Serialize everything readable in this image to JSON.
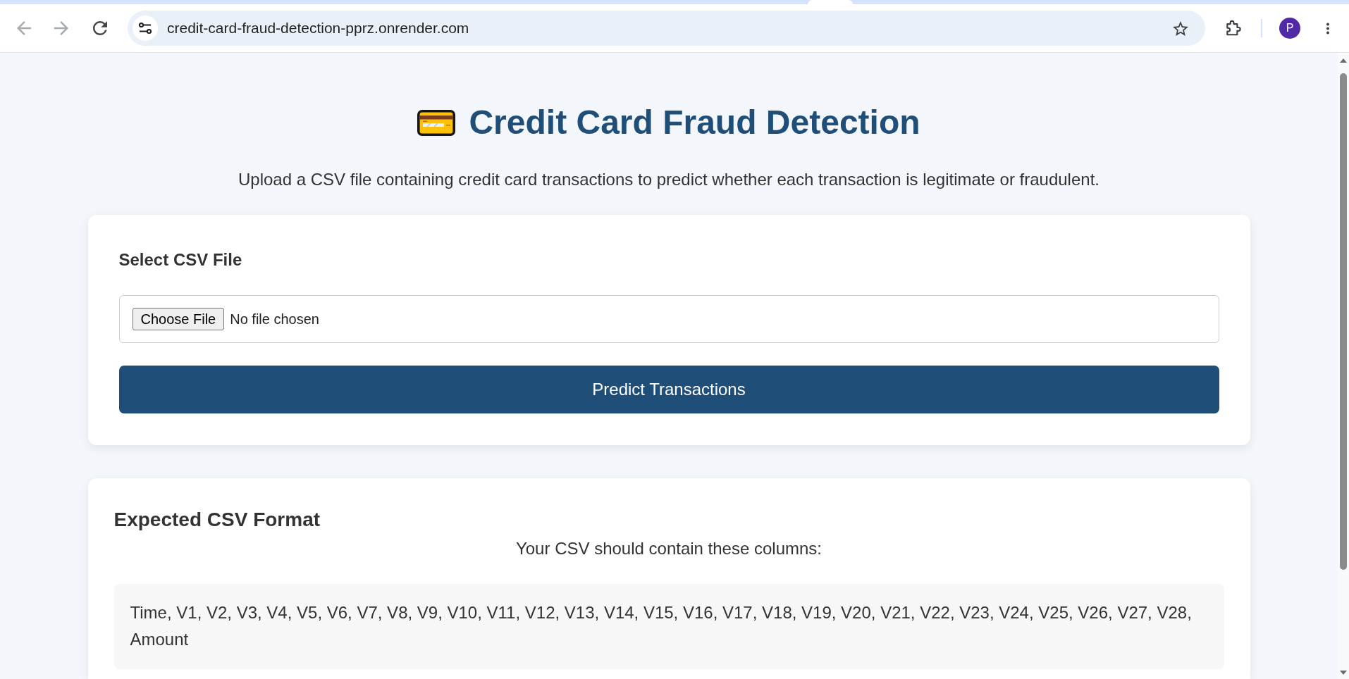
{
  "browser": {
    "back": {
      "disabled": true
    },
    "forward": {
      "disabled": true
    },
    "url": "credit-card-fraud-detection-pprz.onrender.com",
    "bookmarked": false,
    "profile_initial": "P"
  },
  "header": {
    "title": "Credit Card Fraud Detection",
    "subtitle": "Upload a CSV file containing credit card transactions to predict whether each transaction is legitimate or fraudulent."
  },
  "upload_card": {
    "label": "Select CSV File",
    "file_input": {
      "button": "Choose File",
      "status": "No file chosen"
    },
    "submit_button": "Predict Transactions"
  },
  "format_card": {
    "heading": "Expected CSV Format",
    "intro": "Your CSV should contain these columns:",
    "columns": "Time, V1, V2, V3, V4, V5, V6, V7, V8, V9, V10, V11, V12, V13, V14, V15, V16, V17, V18, V19, V20, V21, V22, V23, V24, V25, V26, V27, V28, Amount"
  }
}
